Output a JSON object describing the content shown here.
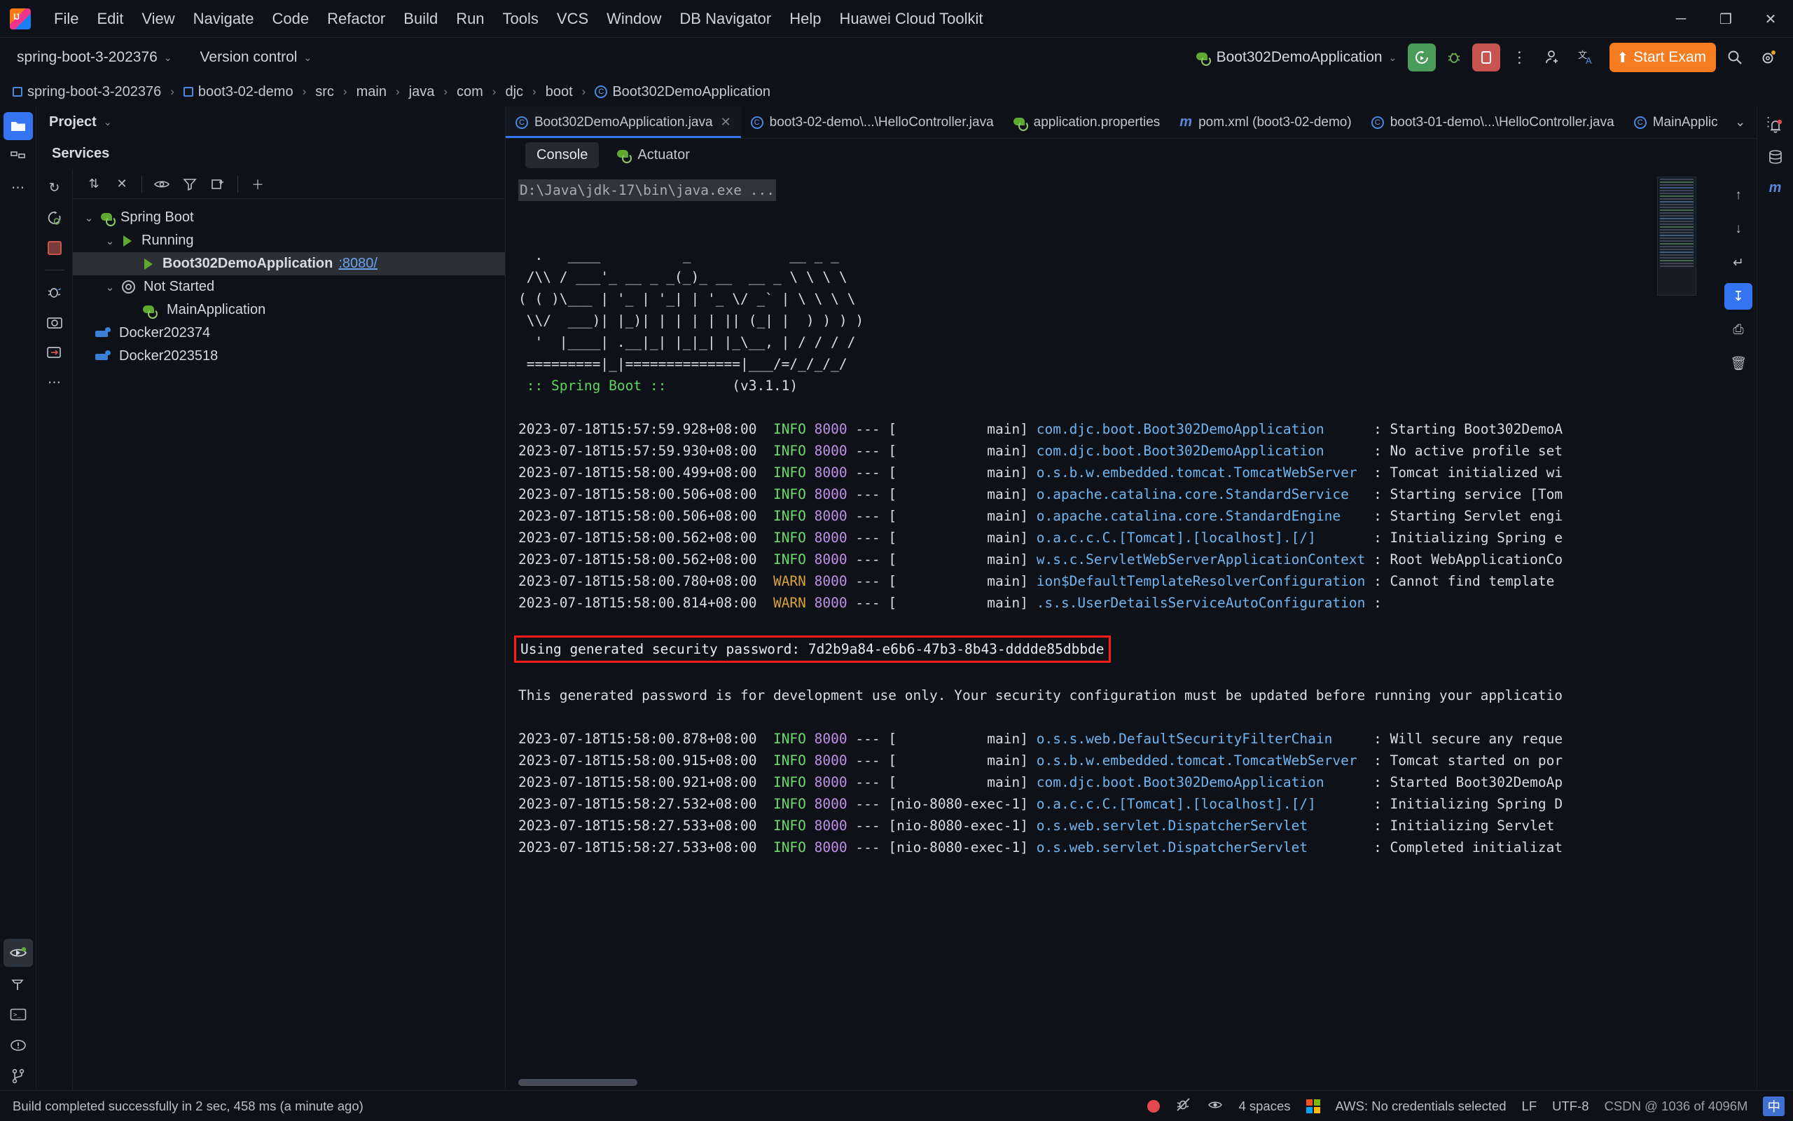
{
  "window": {
    "minimize": "─",
    "maximize": "❐",
    "close": "✕"
  },
  "menubar": {
    "items": [
      "File",
      "Edit",
      "View",
      "Navigate",
      "Code",
      "Refactor",
      "Build",
      "Run",
      "Tools",
      "VCS",
      "Window",
      "DB Navigator",
      "Help",
      "Huawei Cloud Toolkit"
    ]
  },
  "toolbar": {
    "project_name": "spring-boot-3-202376",
    "version_control": "Version control",
    "run_config": "Boot302DemoApplication",
    "more_label": "⋮",
    "start_exam": "Start Exam",
    "search_icon": "search-icon",
    "settings_icon": "gear-icon",
    "accent_orange": "#f57c1f",
    "accent_green": "#4a9c5b",
    "accent_red": "#c75450"
  },
  "breadcrumb": {
    "items": [
      {
        "label": "spring-boot-3-202376",
        "icon": "module-icon"
      },
      {
        "label": "boot3-02-demo",
        "icon": "module-icon"
      },
      {
        "label": "src",
        "icon": ""
      },
      {
        "label": "main",
        "icon": ""
      },
      {
        "label": "java",
        "icon": ""
      },
      {
        "label": "com",
        "icon": ""
      },
      {
        "label": "djc",
        "icon": ""
      },
      {
        "label": "boot",
        "icon": ""
      },
      {
        "label": "Boot302DemoApplication",
        "icon": "spring-class-icon"
      }
    ],
    "separator": "›"
  },
  "left_rail": {
    "items": [
      {
        "name": "project-tool-icon",
        "glyph": "⬛",
        "active": true
      },
      {
        "name": "structure-tool-icon",
        "glyph": "◫",
        "active": false
      },
      {
        "name": "more-tool-windows-icon",
        "glyph": "⋯",
        "active": false
      }
    ],
    "bottom_items": [
      {
        "name": "services-tool-icon",
        "glyph": "▷",
        "active": false
      },
      {
        "name": "build-tool-icon",
        "glyph": "⚒",
        "active": false
      },
      {
        "name": "terminal-tool-icon",
        "glyph": "▣",
        "active": false
      },
      {
        "name": "problems-tool-icon",
        "glyph": "ⓘ",
        "active": false
      },
      {
        "name": "version-control-tool-icon",
        "glyph": "⑂",
        "active": false
      }
    ]
  },
  "right_rail": {
    "items": [
      {
        "name": "notifications-icon",
        "glyph": "🔔"
      },
      {
        "name": "database-icon",
        "glyph": "▤"
      },
      {
        "name": "maven-icon",
        "glyph": "m"
      }
    ]
  },
  "project_panel": {
    "title": "Project",
    "chevron": "⌄"
  },
  "services": {
    "title": "Services",
    "rail_icons": [
      {
        "name": "rerun-icon",
        "glyph": "↻"
      },
      {
        "name": "rerun-debug-icon",
        "glyph": "↻"
      },
      {
        "name": "stop-icon",
        "glyph": "■"
      },
      {
        "name": "debug-icon",
        "glyph": "🐞"
      },
      {
        "name": "camera-icon",
        "glyph": "◎"
      },
      {
        "name": "attach-icon",
        "glyph": "⇥"
      },
      {
        "name": "more-icon",
        "glyph": "⋯"
      }
    ],
    "toolbar_icons": [
      {
        "name": "expand-collapse-icon",
        "glyph": "⇅"
      },
      {
        "name": "close-all-icon",
        "glyph": "✕"
      },
      {
        "name": "show-hide-icon",
        "glyph": "◉"
      },
      {
        "name": "filter-icon",
        "glyph": "∇"
      },
      {
        "name": "group-icon",
        "glyph": "⧉"
      },
      {
        "name": "add-service-icon",
        "glyph": "＋"
      }
    ],
    "tree": [
      {
        "id": "spring-boot",
        "label": "Spring Boot",
        "depth": 0,
        "arrow": "⌄",
        "icon": "spring-leaf-icon",
        "selected": false,
        "suffix": ""
      },
      {
        "id": "running",
        "label": "Running",
        "depth": 1,
        "arrow": "⌄",
        "icon": "run-triangle-icon",
        "selected": false,
        "suffix": ""
      },
      {
        "id": "boot302demoapplication",
        "label": "Boot302DemoApplication",
        "depth": 2,
        "arrow": "",
        "icon": "run-triangle-icon",
        "selected": true,
        "suffix": ":8080/"
      },
      {
        "id": "not-started",
        "label": "Not Started",
        "depth": 1,
        "arrow": "⌄",
        "icon": "gear-icon",
        "selected": false,
        "suffix": ""
      },
      {
        "id": "mainapplication",
        "label": "MainApplication",
        "depth": 2,
        "arrow": "",
        "icon": "spring-leaf-icon",
        "selected": false,
        "suffix": ""
      },
      {
        "id": "docker202374",
        "label": "Docker202374",
        "depth": 0,
        "arrow": "",
        "icon": "docker-icon",
        "selected": false,
        "suffix": ""
      },
      {
        "id": "docker2023518",
        "label": "Docker2023518",
        "depth": 0,
        "arrow": "",
        "icon": "docker-icon",
        "selected": false,
        "suffix": ""
      }
    ]
  },
  "editor_tabs": [
    {
      "label": "Boot302DemoApplication.java",
      "icon": "spring-class-icon",
      "active": true,
      "closable": true
    },
    {
      "label": "boot3-02-demo\\...\\HelloController.java",
      "icon": "java-class-icon",
      "active": false,
      "closable": false
    },
    {
      "label": "application.properties",
      "icon": "spring-properties-icon",
      "active": false,
      "closable": false
    },
    {
      "label": "pom.xml (boot3-02-demo)",
      "icon": "maven-icon",
      "active": false,
      "closable": false
    },
    {
      "label": "boot3-01-demo\\...\\HelloController.java",
      "icon": "java-class-icon",
      "active": false,
      "closable": false
    },
    {
      "label": "MainApplic",
      "icon": "spring-class-icon",
      "active": false,
      "closable": false
    }
  ],
  "editor_tabs_right": {
    "chevron": "⌄",
    "more": "⋮"
  },
  "console_tabs": [
    {
      "label": "Console",
      "icon": "",
      "active": true
    },
    {
      "label": "Actuator",
      "icon": "actuator-icon",
      "active": false
    }
  ],
  "console": {
    "command": "D:\\Java\\jdk-17\\bin\\java.exe ...",
    "banner_lines": [
      "  .   ____          _            __ _ _",
      " /\\\\ / ___'_ __ _ _(_)_ __  __ _ \\ \\ \\ \\",
      "( ( )\\___ | '_ | '_| | '_ \\/ _` | \\ \\ \\ \\",
      " \\\\/  ___)| |_)| | | | | || (_| |  ) ) ) )",
      "  '  |____| .__|_| |_|_| |_\\__, | / / / /",
      " =========|_|==============|___/=/_/_/_/"
    ],
    "banner_name": " :: Spring Boot :: ",
    "banner_version": "       (v3.1.1)",
    "log_lines": [
      {
        "ts": "2023-07-18T15:57:59.928+08:00",
        "level": "INFO",
        "pid": "8000",
        "thread": "main",
        "logger": "com.djc.boot.Boot302DemoApplication",
        "msg": "Starting Boot302DemoA"
      },
      {
        "ts": "2023-07-18T15:57:59.930+08:00",
        "level": "INFO",
        "pid": "8000",
        "thread": "main",
        "logger": "com.djc.boot.Boot302DemoApplication",
        "msg": "No active profile set"
      },
      {
        "ts": "2023-07-18T15:58:00.499+08:00",
        "level": "INFO",
        "pid": "8000",
        "thread": "main",
        "logger": "o.s.b.w.embedded.tomcat.TomcatWebServer",
        "msg": "Tomcat initialized wi"
      },
      {
        "ts": "2023-07-18T15:58:00.506+08:00",
        "level": "INFO",
        "pid": "8000",
        "thread": "main",
        "logger": "o.apache.catalina.core.StandardService",
        "msg": "Starting service [Tom"
      },
      {
        "ts": "2023-07-18T15:58:00.506+08:00",
        "level": "INFO",
        "pid": "8000",
        "thread": "main",
        "logger": "o.apache.catalina.core.StandardEngine",
        "msg": "Starting Servlet engi"
      },
      {
        "ts": "2023-07-18T15:58:00.562+08:00",
        "level": "INFO",
        "pid": "8000",
        "thread": "main",
        "logger": "o.a.c.c.C.[Tomcat].[localhost].[/]",
        "msg": "Initializing Spring e"
      },
      {
        "ts": "2023-07-18T15:58:00.562+08:00",
        "level": "INFO",
        "pid": "8000",
        "thread": "main",
        "logger": "w.s.c.ServletWebServerApplicationContext",
        "msg": "Root WebApplicationCo"
      },
      {
        "ts": "2023-07-18T15:58:00.780+08:00",
        "level": "WARN",
        "pid": "8000",
        "thread": "main",
        "logger": "ion$DefaultTemplateResolverConfiguration",
        "msg": "Cannot find template"
      },
      {
        "ts": "2023-07-18T15:58:00.814+08:00",
        "level": "WARN",
        "pid": "8000",
        "thread": "main",
        "logger": ".s.s.UserDetailsServiceAutoConfiguration",
        "msg": ""
      }
    ],
    "password_line": "Using generated security password: 7d2b9a84-e6b6-47b3-8b43-dddde85dbbde",
    "password_highlight_color": "#ff1a1a",
    "password_note": "This generated password is for development use only. Your security configuration must be updated before running your applicatio",
    "log_lines_2": [
      {
        "ts": "2023-07-18T15:58:00.878+08:00",
        "level": "INFO",
        "pid": "8000",
        "thread": "main",
        "logger": "o.s.s.web.DefaultSecurityFilterChain",
        "msg": "Will secure any reque"
      },
      {
        "ts": "2023-07-18T15:58:00.915+08:00",
        "level": "INFO",
        "pid": "8000",
        "thread": "main",
        "logger": "o.s.b.w.embedded.tomcat.TomcatWebServer",
        "msg": "Tomcat started on por"
      },
      {
        "ts": "2023-07-18T15:58:00.921+08:00",
        "level": "INFO",
        "pid": "8000",
        "thread": "main",
        "logger": "com.djc.boot.Boot302DemoApplication",
        "msg": "Started Boot302DemoAp"
      },
      {
        "ts": "2023-07-18T15:58:27.532+08:00",
        "level": "INFO",
        "pid": "8000",
        "thread": "nio-8080-exec-1",
        "logger": "o.a.c.c.C.[Tomcat].[localhost].[/]",
        "msg": "Initializing Spring D"
      },
      {
        "ts": "2023-07-18T15:58:27.533+08:00",
        "level": "INFO",
        "pid": "8000",
        "thread": "nio-8080-exec-1",
        "logger": "o.s.web.servlet.DispatcherServlet",
        "msg": "Initializing Servlet"
      },
      {
        "ts": "2023-07-18T15:58:27.533+08:00",
        "level": "INFO",
        "pid": "8000",
        "thread": "nio-8080-exec-1",
        "logger": "o.s.web.servlet.DispatcherServlet",
        "msg": "Completed initializat"
      }
    ],
    "side_tools": [
      {
        "name": "scroll-up-icon",
        "glyph": "↑"
      },
      {
        "name": "scroll-down-icon",
        "glyph": "↓"
      },
      {
        "name": "soft-wrap-icon",
        "glyph": "↵"
      },
      {
        "name": "scroll-to-end-icon",
        "glyph": "↧",
        "active": true
      },
      {
        "name": "print-icon",
        "glyph": "⎙"
      },
      {
        "name": "clear-all-icon",
        "glyph": "🗑"
      }
    ]
  },
  "statusbar": {
    "build_message": "Build completed successfully in 2 sec, 458 ms (a minute ago)",
    "record_icon": "record-icon",
    "bug_off_icon": "bug-disabled-icon",
    "eye_icon": "eye-icon",
    "indent": "4 spaces",
    "aws": "AWS: No credentials selected",
    "line_separator": "LF",
    "encoding": "UTF-8",
    "extra": "CSDN @ 1036 of 4096M",
    "ime": "中"
  }
}
